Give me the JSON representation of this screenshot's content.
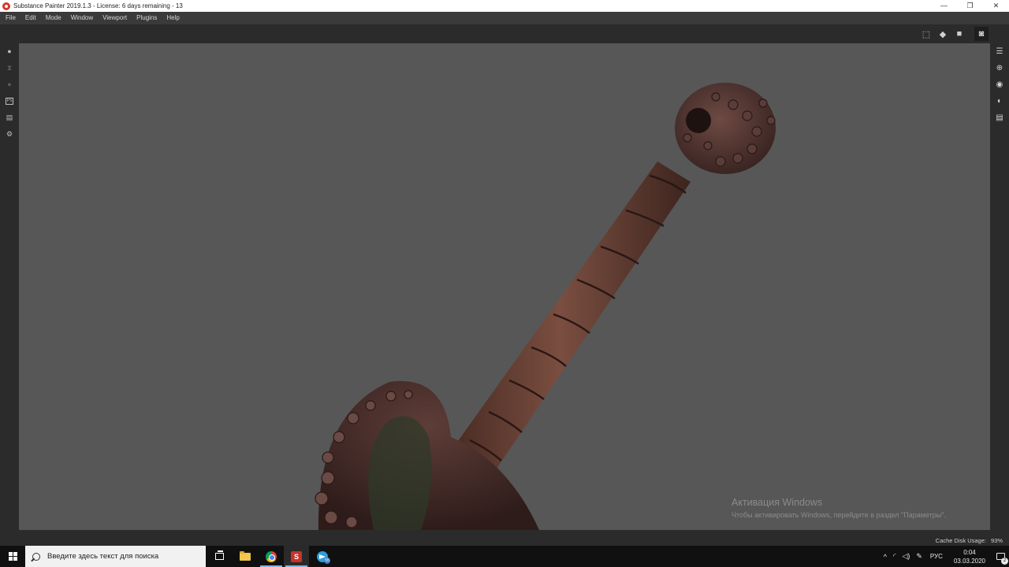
{
  "window": {
    "title": "Substance Painter 2019.1.3 - License: 6 days remaining - 13",
    "minimize_glyph": "—",
    "maximize_glyph": "❐",
    "close_glyph": "✕"
  },
  "menu": [
    "File",
    "Edit",
    "Mode",
    "Window",
    "Viewport",
    "Plugins",
    "Help"
  ],
  "left_tools": [
    {
      "icon": "paint-brush-icon",
      "glyph": "●",
      "dim": false
    },
    {
      "icon": "hourglass-icon",
      "glyph": "⧗",
      "dim": true
    },
    {
      "icon": "eraser-icon",
      "glyph": "●",
      "dim": true
    },
    {
      "icon": "photoshop-export-icon",
      "glyph": "Ps",
      "dim": false
    },
    {
      "icon": "document-icon",
      "glyph": "▤",
      "dim": false
    },
    {
      "icon": "settings-icon",
      "glyph": "⚙",
      "dim": false
    }
  ],
  "right_tools": [
    {
      "icon": "layers-icon",
      "glyph": "☰"
    },
    {
      "icon": "zoom-icon",
      "glyph": "⊕"
    },
    {
      "icon": "display-settings-icon",
      "glyph": "◉"
    },
    {
      "icon": "environment-icon",
      "glyph": "◐"
    },
    {
      "icon": "log-icon",
      "glyph": "▤"
    }
  ],
  "viewport_toolbar": [
    {
      "icon": "frame-selection-icon",
      "glyph": "⬚"
    },
    {
      "icon": "object-view-icon",
      "glyph": "◆"
    },
    {
      "icon": "camera-video-icon",
      "glyph": "■"
    },
    {
      "icon": "screenshot-camera-icon",
      "glyph": "◙"
    }
  ],
  "watermark": {
    "title": "Активация Windows",
    "subtitle": "Чтобы активировать Windows, перейдите в раздел \"Параметры\"."
  },
  "status": {
    "cache_label": "Cache Disk Usage:",
    "cache_value": "93%"
  },
  "taskbar": {
    "search_placeholder": "Введите здесь текст для поиска",
    "telegram_badge": "55",
    "tray": {
      "chevron": "^",
      "network": "◜",
      "volume": "◁)",
      "pen": "✎",
      "language": "РУС",
      "time": "0:04",
      "date": "03.03.2020",
      "notifications_count": "2"
    }
  },
  "colors": {
    "viewport_bg": "#575757",
    "ui_dark": "#2b2b2b",
    "menu_bg": "#3a3a3a",
    "taskbar_bg": "#101010",
    "model_rust": "#6a4236"
  }
}
